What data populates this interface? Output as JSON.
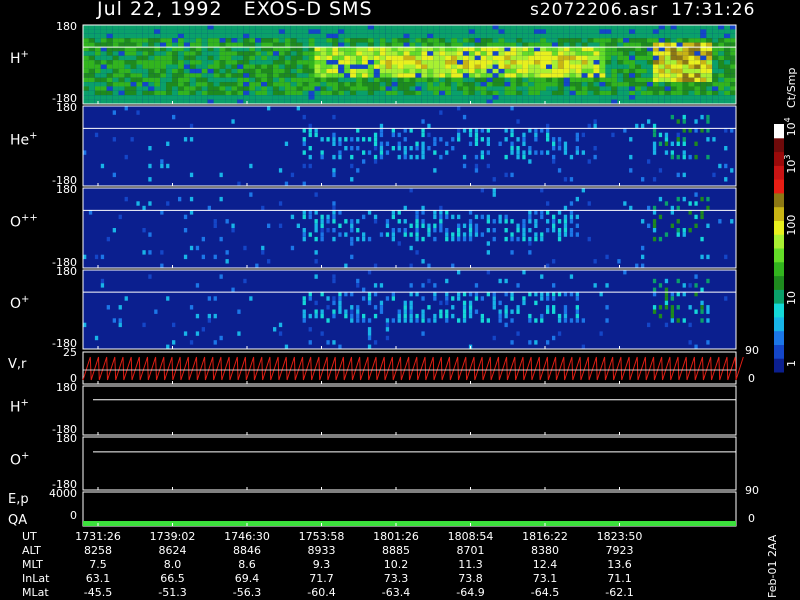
{
  "header": {
    "date": "Jul 22, 1992",
    "instrument": "EXOS-D SMS",
    "file": "s2072206.asr",
    "time": "17:31:26"
  },
  "chart_data": [
    {
      "type": "heatmap",
      "panels": [
        {
          "label": "H",
          "superscript": "+",
          "ylim": [
            -180,
            180
          ],
          "ytick_labels": [
            "180",
            "-180"
          ]
        },
        {
          "label": "He",
          "superscript": "+",
          "ylim": [
            -180,
            180
          ],
          "ytick_labels": [
            "180",
            "-180"
          ]
        },
        {
          "label": "O",
          "superscript": "++",
          "ylim": [
            -180,
            180
          ],
          "ytick_labels": [
            "180",
            "-180"
          ]
        },
        {
          "label": "O",
          "superscript": "+",
          "ylim": [
            -180,
            180
          ],
          "ytick_labels": [
            "180",
            "-180"
          ]
        }
      ],
      "colorbar": {
        "label": "Ct/Smp",
        "tick_labels": [
          "1",
          "10",
          "100",
          "10",
          "10"
        ],
        "tick_superscripts": [
          "",
          "",
          "",
          "3",
          "4"
        ],
        "colors": [
          "#0b1f8f",
          "#1446c8",
          "#1c77e8",
          "#18b4e8",
          "#14d8d8",
          "#0aa06a",
          "#1e8a1e",
          "#32b41e",
          "#64dc28",
          "#a8f032",
          "#e8f01e",
          "#c8b414",
          "#8c7814",
          "#e81e14",
          "#c81414",
          "#9a0a0a",
          "#6e0a0a",
          "#ffffff"
        ]
      }
    },
    {
      "type": "line",
      "label": "V,r",
      "left_ticks": [
        "25",
        "0"
      ],
      "right_ticks": [
        "90",
        "0"
      ]
    },
    {
      "type": "line",
      "label": "H",
      "superscript": "+",
      "ytick_labels": [
        "180",
        "-180"
      ]
    },
    {
      "type": "line",
      "label": "O",
      "superscript": "+",
      "ytick_labels": [
        "180",
        "-180"
      ]
    },
    {
      "type": "line",
      "label": "E,p",
      "label2": "QA",
      "left_ticks": [
        "4000",
        "0"
      ],
      "right_ticks": [
        "90",
        "0"
      ]
    }
  ],
  "table": {
    "rows": [
      {
        "name": "UT",
        "values": [
          "1731:26",
          "1739:02",
          "1746:30",
          "1753:58",
          "1801:26",
          "1808:54",
          "1816:22",
          "1823:50"
        ]
      },
      {
        "name": "ALT",
        "values": [
          "8258",
          "8624",
          "8846",
          "8933",
          "8885",
          "8701",
          "8380",
          "7923"
        ]
      },
      {
        "name": "MLT",
        "values": [
          "7.5",
          "8.0",
          "8.6",
          "9.3",
          "10.2",
          "11.3",
          "12.4",
          "13.6"
        ]
      },
      {
        "name": "InLat",
        "values": [
          "63.1",
          "66.5",
          "69.4",
          "71.7",
          "73.3",
          "73.8",
          "73.1",
          "71.1"
        ]
      },
      {
        "name": "MLat",
        "values": [
          "-45.5",
          "-51.3",
          "-56.3",
          "-60.4",
          "-63.4",
          "-64.9",
          "-64.5",
          "-62.1"
        ]
      }
    ]
  },
  "footer": {
    "stamp": "Feb-01 2AA"
  }
}
